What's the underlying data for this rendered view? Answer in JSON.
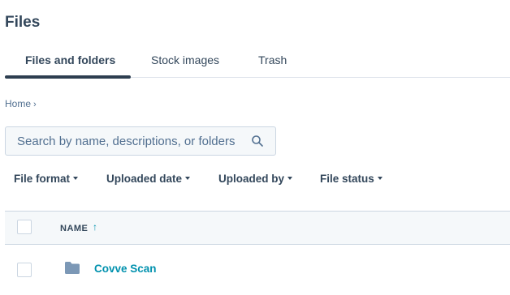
{
  "page": {
    "title": "Files"
  },
  "tabs": [
    {
      "label": "Files and folders",
      "active": true
    },
    {
      "label": "Stock images",
      "active": false
    },
    {
      "label": "Trash",
      "active": false
    }
  ],
  "breadcrumb": {
    "home": "Home",
    "separator": "›"
  },
  "search": {
    "placeholder": "Search by name, descriptions, or folders",
    "value": "",
    "icon": "search-icon"
  },
  "filters": [
    {
      "label": "File format"
    },
    {
      "label": "Uploaded date"
    },
    {
      "label": "Uploaded by"
    },
    {
      "label": "File status"
    }
  ],
  "table": {
    "columns": [
      {
        "label": "NAME",
        "sort": "ascending",
        "sort_icon": "↑"
      }
    ],
    "rows": [
      {
        "name": "Covve Scan",
        "type": "folder",
        "icon": "folder-icon"
      }
    ]
  },
  "colors": {
    "accent": "#0091ae",
    "text": "#33475b",
    "tab_indicator": "#2d3e50",
    "header_bg": "#f5f8fa",
    "border": "#cbd6e2"
  }
}
